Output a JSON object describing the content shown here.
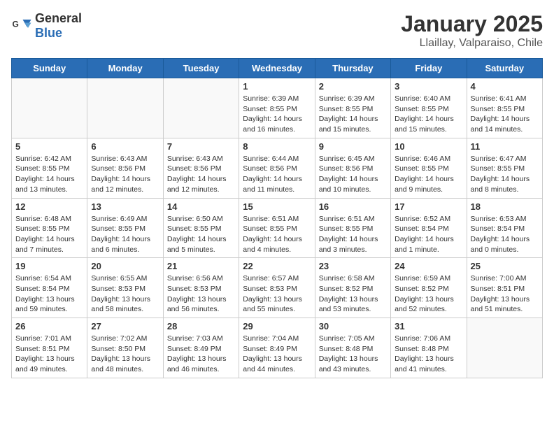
{
  "header": {
    "logo_general": "General",
    "logo_blue": "Blue",
    "month": "January 2025",
    "location": "Llaillay, Valparaiso, Chile"
  },
  "days_of_week": [
    "Sunday",
    "Monday",
    "Tuesday",
    "Wednesday",
    "Thursday",
    "Friday",
    "Saturday"
  ],
  "weeks": [
    [
      {
        "day": "",
        "info": ""
      },
      {
        "day": "",
        "info": ""
      },
      {
        "day": "",
        "info": ""
      },
      {
        "day": "1",
        "info": "Sunrise: 6:39 AM\nSunset: 8:55 PM\nDaylight: 14 hours\nand 16 minutes."
      },
      {
        "day": "2",
        "info": "Sunrise: 6:39 AM\nSunset: 8:55 PM\nDaylight: 14 hours\nand 15 minutes."
      },
      {
        "day": "3",
        "info": "Sunrise: 6:40 AM\nSunset: 8:55 PM\nDaylight: 14 hours\nand 15 minutes."
      },
      {
        "day": "4",
        "info": "Sunrise: 6:41 AM\nSunset: 8:55 PM\nDaylight: 14 hours\nand 14 minutes."
      }
    ],
    [
      {
        "day": "5",
        "info": "Sunrise: 6:42 AM\nSunset: 8:55 PM\nDaylight: 14 hours\nand 13 minutes."
      },
      {
        "day": "6",
        "info": "Sunrise: 6:43 AM\nSunset: 8:56 PM\nDaylight: 14 hours\nand 12 minutes."
      },
      {
        "day": "7",
        "info": "Sunrise: 6:43 AM\nSunset: 8:56 PM\nDaylight: 14 hours\nand 12 minutes."
      },
      {
        "day": "8",
        "info": "Sunrise: 6:44 AM\nSunset: 8:56 PM\nDaylight: 14 hours\nand 11 minutes."
      },
      {
        "day": "9",
        "info": "Sunrise: 6:45 AM\nSunset: 8:56 PM\nDaylight: 14 hours\nand 10 minutes."
      },
      {
        "day": "10",
        "info": "Sunrise: 6:46 AM\nSunset: 8:55 PM\nDaylight: 14 hours\nand 9 minutes."
      },
      {
        "day": "11",
        "info": "Sunrise: 6:47 AM\nSunset: 8:55 PM\nDaylight: 14 hours\nand 8 minutes."
      }
    ],
    [
      {
        "day": "12",
        "info": "Sunrise: 6:48 AM\nSunset: 8:55 PM\nDaylight: 14 hours\nand 7 minutes."
      },
      {
        "day": "13",
        "info": "Sunrise: 6:49 AM\nSunset: 8:55 PM\nDaylight: 14 hours\nand 6 minutes."
      },
      {
        "day": "14",
        "info": "Sunrise: 6:50 AM\nSunset: 8:55 PM\nDaylight: 14 hours\nand 5 minutes."
      },
      {
        "day": "15",
        "info": "Sunrise: 6:51 AM\nSunset: 8:55 PM\nDaylight: 14 hours\nand 4 minutes."
      },
      {
        "day": "16",
        "info": "Sunrise: 6:51 AM\nSunset: 8:55 PM\nDaylight: 14 hours\nand 3 minutes."
      },
      {
        "day": "17",
        "info": "Sunrise: 6:52 AM\nSunset: 8:54 PM\nDaylight: 14 hours\nand 1 minute."
      },
      {
        "day": "18",
        "info": "Sunrise: 6:53 AM\nSunset: 8:54 PM\nDaylight: 14 hours\nand 0 minutes."
      }
    ],
    [
      {
        "day": "19",
        "info": "Sunrise: 6:54 AM\nSunset: 8:54 PM\nDaylight: 13 hours\nand 59 minutes."
      },
      {
        "day": "20",
        "info": "Sunrise: 6:55 AM\nSunset: 8:53 PM\nDaylight: 13 hours\nand 58 minutes."
      },
      {
        "day": "21",
        "info": "Sunrise: 6:56 AM\nSunset: 8:53 PM\nDaylight: 13 hours\nand 56 minutes."
      },
      {
        "day": "22",
        "info": "Sunrise: 6:57 AM\nSunset: 8:53 PM\nDaylight: 13 hours\nand 55 minutes."
      },
      {
        "day": "23",
        "info": "Sunrise: 6:58 AM\nSunset: 8:52 PM\nDaylight: 13 hours\nand 53 minutes."
      },
      {
        "day": "24",
        "info": "Sunrise: 6:59 AM\nSunset: 8:52 PM\nDaylight: 13 hours\nand 52 minutes."
      },
      {
        "day": "25",
        "info": "Sunrise: 7:00 AM\nSunset: 8:51 PM\nDaylight: 13 hours\nand 51 minutes."
      }
    ],
    [
      {
        "day": "26",
        "info": "Sunrise: 7:01 AM\nSunset: 8:51 PM\nDaylight: 13 hours\nand 49 minutes."
      },
      {
        "day": "27",
        "info": "Sunrise: 7:02 AM\nSunset: 8:50 PM\nDaylight: 13 hours\nand 48 minutes."
      },
      {
        "day": "28",
        "info": "Sunrise: 7:03 AM\nSunset: 8:49 PM\nDaylight: 13 hours\nand 46 minutes."
      },
      {
        "day": "29",
        "info": "Sunrise: 7:04 AM\nSunset: 8:49 PM\nDaylight: 13 hours\nand 44 minutes."
      },
      {
        "day": "30",
        "info": "Sunrise: 7:05 AM\nSunset: 8:48 PM\nDaylight: 13 hours\nand 43 minutes."
      },
      {
        "day": "31",
        "info": "Sunrise: 7:06 AM\nSunset: 8:48 PM\nDaylight: 13 hours\nand 41 minutes."
      },
      {
        "day": "",
        "info": ""
      }
    ]
  ]
}
